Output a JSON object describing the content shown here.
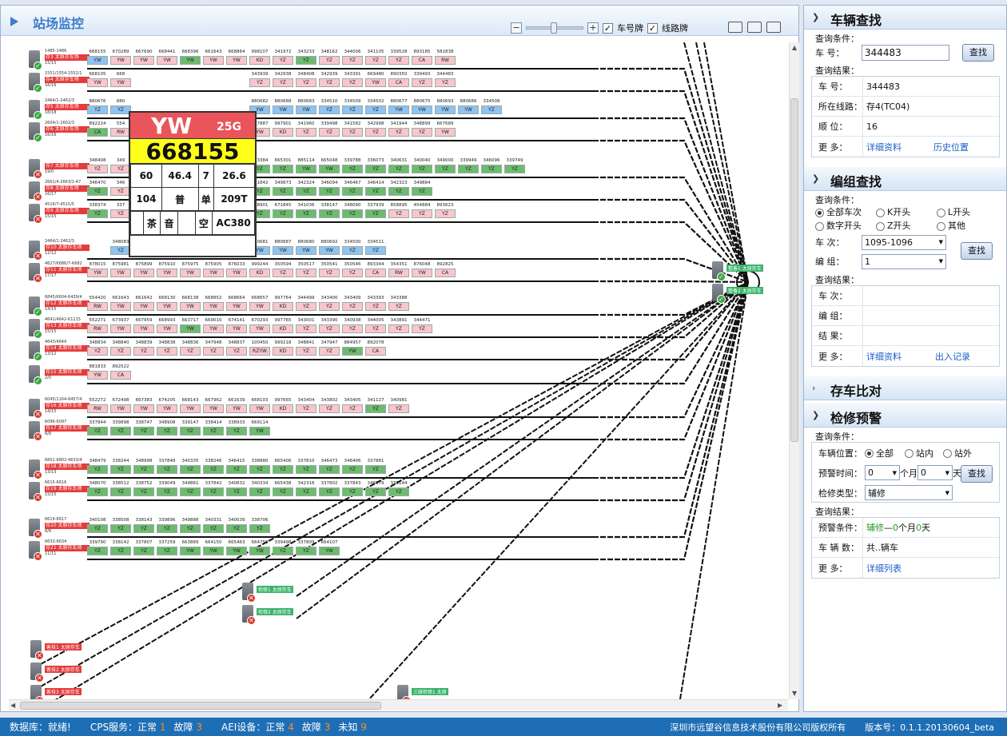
{
  "panel_title": "站场监控",
  "toolbar": {
    "zoom_out": "−",
    "zoom_in": "+",
    "car_plate_label": "车号牌",
    "line_plate_label": "线路牌"
  },
  "popup": {
    "type": "YW",
    "grade": "25G",
    "number": "668155",
    "cells": [
      [
        "60",
        "46.4",
        "7",
        "26.6"
      ],
      [
        "104",
        "普",
        "单",
        "209T"
      ],
      [
        "",
        "茶",
        "音",
        "",
        "空",
        "AC380"
      ]
    ]
  },
  "tracks": [
    {
      "name": "存3 太原存车场",
      "code": "1485-1486",
      "count": "15/15",
      "status": "ok",
      "nums": [
        "668155",
        "670289",
        "667690",
        "668441",
        "668396",
        "661643",
        "668864",
        "998107",
        "341972",
        "343233",
        "348162",
        "344006",
        "341105",
        "339528",
        "893185",
        "581838"
      ],
      "types": [
        "YW",
        "YW",
        "YW",
        "YW",
        "YW",
        "YW",
        "YW",
        "KD",
        "YZ",
        "YZ",
        "YZ",
        "YZ",
        "YZ",
        "YZ",
        "CA",
        "RW"
      ],
      "colors": [
        "b",
        "p",
        "p",
        "p",
        "g",
        "p",
        "p",
        "p",
        "p",
        "g",
        "p",
        "p",
        "p",
        "p",
        "p",
        "p"
      ]
    },
    {
      "name": "存4 太原存车场",
      "code": "1551/1554-1552/1",
      "count": "16/16",
      "status": "ok",
      "nums": [
        "668105",
        "668",
        "",
        "",
        "",
        "",
        "",
        "343939",
        "342938",
        "348408",
        "342939",
        "343391",
        "669480",
        "890350",
        "339493",
        "344483"
      ],
      "types": [
        "YW",
        "YW",
        "",
        "",
        "",
        "",
        "",
        "YZ",
        "YZ",
        "YZ",
        "YZ",
        "YZ",
        "YW",
        "CA",
        "YZ",
        "YZ"
      ],
      "colors": [
        "p",
        "p",
        "p",
        "p",
        "p",
        "p",
        "p",
        "p",
        "p",
        "p",
        "p",
        "p",
        "p",
        "p",
        "p",
        "p"
      ]
    },
    {
      "name": "存5 太原存车场",
      "code": "2464/1-2462/3",
      "count": "18/18",
      "status": "ok",
      "nums": [
        "880676",
        "880",
        "",
        "",
        "",
        "",
        "",
        "880682",
        "880688",
        "880683",
        "334510",
        "334509",
        "334502",
        "880677",
        "880675",
        "880693",
        "880686",
        "334508"
      ],
      "types": [
        "YZ",
        "YZ",
        "",
        "",
        "",
        "",
        "",
        "YW",
        "YW",
        "YW",
        "YZ",
        "YZ",
        "YZ",
        "YW",
        "YW",
        "YW",
        "YW",
        "YZ"
      ],
      "colors": [
        "b",
        "b",
        "b",
        "b",
        "b",
        "b",
        "b",
        "b",
        "b",
        "b",
        "b",
        "b",
        "b",
        "b",
        "b",
        "b",
        "b",
        "b"
      ]
    },
    {
      "name": "存6 太原存车场",
      "code": "2604/1-2602/3",
      "count": "16/16",
      "status": "ok",
      "nums": [
        "892224",
        "554",
        "",
        "",
        "",
        "",
        "",
        "667887",
        "997901",
        "341960",
        "339498",
        "341582",
        "342998",
        "341944",
        "348899",
        "667689"
      ],
      "types": [
        "CA",
        "RW",
        "",
        "",
        "",
        "",
        "",
        "YW",
        "KD",
        "YZ",
        "YZ",
        "YZ",
        "YZ",
        "YZ",
        "YZ",
        "YW"
      ],
      "colors": [
        "g",
        "p",
        "p",
        "p",
        "p",
        "p",
        "p",
        "p",
        "p",
        "p",
        "p",
        "p",
        "p",
        "p",
        "p",
        "p"
      ]
    },
    {
      "name": "存7 太原存车场",
      "code": "",
      "count": "19/0",
      "status": "err",
      "nums": [
        "348408",
        "349",
        "",
        "",
        "",
        "",
        "",
        "553384",
        "665301",
        "885114",
        "665048",
        "339788",
        "336073",
        "340631",
        "340040",
        "349000",
        "339949",
        "346096",
        "339749"
      ],
      "types": [
        "YZ",
        "YZ",
        "",
        "",
        "",
        "",
        "",
        "YZ",
        "YZ",
        "YW",
        "YW",
        "YZ",
        "YZ",
        "YZ",
        "YZ",
        "YZ",
        "YZ",
        "YZ",
        "YZ"
      ],
      "colors": [
        "p",
        "p",
        "p",
        "p",
        "p",
        "p",
        "p",
        "g",
        "g",
        "g",
        "g",
        "g",
        "g",
        "g",
        "g",
        "g",
        "g",
        "g",
        "g"
      ]
    },
    {
      "name": "存8 太原存车场",
      "code": "2661/4-2663/1-47",
      "count": "16/17",
      "status": "err",
      "nums": [
        "346470",
        "346",
        "",
        "",
        "",
        "",
        "",
        "671842",
        "349873",
        "342324",
        "346094",
        "346467",
        "346414",
        "342323",
        "349884"
      ],
      "types": [
        "YZ",
        "YZ",
        "",
        "",
        "",
        "",
        "",
        "YZ",
        "YZ",
        "YZ",
        "YZ",
        "YZ",
        "YZ",
        "YZ",
        "YZ"
      ],
      "colors": [
        "g",
        "p",
        "p",
        "p",
        "p",
        "p",
        "p",
        "g",
        "g",
        "g",
        "g",
        "g",
        "g",
        "g",
        "g"
      ]
    },
    {
      "name": "存9 太原存车场",
      "code": "4516/7-4515/5",
      "count": "15/15",
      "status": "err",
      "nums": [
        "338374",
        "337",
        "",
        "",
        "",
        "",
        "",
        "348901",
        "671845",
        "341036",
        "338147",
        "348090",
        "337939",
        "858895",
        "454884",
        "893623"
      ],
      "types": [
        "YZ",
        "YZ",
        "",
        "",
        "",
        "",
        "",
        "YZ",
        "YZ",
        "YZ",
        "YZ",
        "YZ",
        "YZ",
        "YZ",
        "YZ",
        "YZ"
      ],
      "colors": [
        "g",
        "p",
        "p",
        "p",
        "p",
        "p",
        "p",
        "g",
        "g",
        "g",
        "g",
        "g",
        "g",
        "p",
        "p",
        "p"
      ]
    },
    {
      "name": "存10 太原存车场",
      "code": "2464/1-2462/3",
      "count": "12/12",
      "status": "err",
      "nums": [
        "",
        "348083",
        "354306",
        "354513",
        "880678",
        "880689",
        "880684",
        "880681",
        "880687",
        "880680",
        "880692",
        "334500",
        "334511"
      ],
      "types": [
        "",
        "YZ",
        "YZ",
        "YZ",
        "YW",
        "YW",
        "YW",
        "YW",
        "YW",
        "YW",
        "YW",
        "YZ",
        "YZ"
      ],
      "colors": [
        "w",
        "b",
        "b",
        "b",
        "b",
        "b",
        "b",
        "b",
        "b",
        "b",
        "b",
        "b",
        "b"
      ]
    },
    {
      "name": "存11 太原存车场",
      "code": "4627/K686/7-K682",
      "count": "17/17",
      "status": "err",
      "nums": [
        "878015",
        "875981",
        "875899",
        "875910",
        "875975",
        "875905",
        "876033",
        "999244",
        "350594",
        "350517",
        "350541",
        "350546",
        "893344",
        "354351",
        "876048",
        "892825"
      ],
      "types": [
        "YW",
        "YW",
        "YW",
        "YW",
        "YW",
        "YW",
        "YW",
        "KD",
        "YZ",
        "YZ",
        "YZ",
        "YZ",
        "CA",
        "RW",
        "YW",
        "CA"
      ],
      "colors": [
        "p",
        "p",
        "p",
        "p",
        "p",
        "p",
        "p",
        "p",
        "p",
        "p",
        "p",
        "p",
        "p",
        "p",
        "p",
        "p"
      ]
    },
    {
      "name": "存12 太原存车场",
      "code": "6845/K604-6439/4",
      "count": "14/15",
      "status": "ok",
      "nums": [
        "554420",
        "661643",
        "661642",
        "668130",
        "668138",
        "668852",
        "668664",
        "668657",
        "997764",
        "344499",
        "343400",
        "343409",
        "343393",
        "343388"
      ],
      "types": [
        "RW",
        "YW",
        "YW",
        "YW",
        "YW",
        "YW",
        "YW",
        "YW",
        "KD",
        "YZ",
        "YZ",
        "YZ",
        "YZ",
        "YZ"
      ],
      "colors": [
        "p",
        "p",
        "p",
        "p",
        "p",
        "p",
        "p",
        "p",
        "p",
        "p",
        "p",
        "p",
        "p",
        "p"
      ]
    },
    {
      "name": "存13 太原存车场",
      "code": "4641/4642-K1115",
      "count": "15/15",
      "status": "ok",
      "nums": [
        "552271",
        "673937",
        "667959",
        "668993",
        "663717",
        "669010",
        "674141",
        "670293",
        "997765",
        "343001",
        "343390",
        "340938",
        "344005",
        "343891",
        "344471"
      ],
      "types": [
        "RW",
        "YW",
        "YW",
        "YW",
        "YW",
        "YW",
        "YW",
        "YW",
        "KD",
        "YZ",
        "YZ",
        "YZ",
        "YZ",
        "YZ",
        "YZ"
      ],
      "colors": [
        "p",
        "p",
        "p",
        "p",
        "g",
        "p",
        "p",
        "p",
        "p",
        "p",
        "p",
        "p",
        "p",
        "p",
        "p"
      ]
    },
    {
      "name": "存14 太原存车场",
      "code": "4643/4644",
      "count": "13/12",
      "status": "ok",
      "nums": [
        "348834",
        "348840",
        "348839",
        "348838",
        "348836",
        "347948",
        "348837",
        "100450",
        "999218",
        "348841",
        "347947",
        "884957",
        "892078"
      ],
      "types": [
        "YZ",
        "YZ",
        "YZ",
        "YZ",
        "YZ",
        "YZ",
        "YZ",
        "RZYW",
        "KD",
        "YZ",
        "YZ",
        "YW",
        "CA"
      ],
      "colors": [
        "p",
        "p",
        "p",
        "p",
        "p",
        "p",
        "p",
        "p",
        "p",
        "p",
        "p",
        "g",
        "p"
      ]
    },
    {
      "name": "存15 太原存车场",
      "code": "",
      "count": "2/0",
      "status": "ok",
      "nums": [
        "881833",
        "892522"
      ],
      "types": [
        "YW",
        "CA"
      ],
      "colors": [
        "p",
        "p"
      ]
    },
    {
      "name": "存16 太原存车场",
      "code": "6045/1164-6457/4",
      "count": "14/15",
      "status": "err",
      "nums": [
        "552272",
        "672498",
        "667383",
        "674205",
        "668143",
        "667962",
        "661639",
        "668103",
        "997665",
        "343404",
        "343802",
        "343405",
        "341127",
        "340981"
      ],
      "types": [
        "RW",
        "YW",
        "YW",
        "YW",
        "YW",
        "YW",
        "YW",
        "YW",
        "KD",
        "YZ",
        "YZ",
        "YZ",
        "YZ",
        "YZ"
      ],
      "colors": [
        "p",
        "p",
        "p",
        "p",
        "p",
        "p",
        "p",
        "p",
        "p",
        "p",
        "p",
        "p",
        "g",
        "p"
      ]
    },
    {
      "name": "存17 太原存车场",
      "code": "6096-6097",
      "count": "8/8",
      "status": "err",
      "nums": [
        "337844",
        "339898",
        "338747",
        "348908",
        "339147",
        "338414",
        "338933",
        "669114"
      ],
      "types": [
        "YZ",
        "YZ",
        "YZ",
        "YZ",
        "YZ",
        "YZ",
        "YZ",
        "YW"
      ],
      "colors": [
        "g",
        "g",
        "g",
        "g",
        "g",
        "g",
        "g",
        "g"
      ]
    },
    {
      "name": "存18 太原存车场",
      "code": "6801-6802-4633/4",
      "count": "13/13",
      "status": "err",
      "nums": [
        "348479",
        "338244",
        "348998",
        "337848",
        "340335",
        "338246",
        "346415",
        "338880",
        "665406",
        "337810",
        "346473",
        "346406",
        "337881"
      ],
      "types": [
        "YZ",
        "YZ",
        "YZ",
        "YZ",
        "YZ",
        "YZ",
        "YZ",
        "YZ",
        "YZ",
        "YZ",
        "YZ",
        "YZ",
        "YZ"
      ],
      "colors": [
        "g",
        "g",
        "g",
        "g",
        "g",
        "g",
        "g",
        "g",
        "g",
        "g",
        "g",
        "g",
        "g"
      ]
    },
    {
      "name": "存19 太原存车场",
      "code": "6615-6616",
      "count": "15/15",
      "status": "err",
      "nums": [
        "348070",
        "338512",
        "338752",
        "339049",
        "349861",
        "337842",
        "340832",
        "340334",
        "665438",
        "342316",
        "337802",
        "337843",
        "346079",
        "338144"
      ],
      "types": [
        "YZ",
        "YZ",
        "YZ",
        "YZ",
        "YZ",
        "YZ",
        "YZ",
        "YZ",
        "YZ",
        "YZ",
        "YZ",
        "YZ",
        "YZ",
        "YZ"
      ],
      "colors": [
        "g",
        "g",
        "g",
        "g",
        "g",
        "g",
        "g",
        "g",
        "g",
        "g",
        "g",
        "g",
        "g",
        "g"
      ]
    },
    {
      "name": "存20 太原存车场",
      "code": "6619-6617",
      "count": "8/8",
      "status": "err",
      "nums": [
        "340108",
        "338508",
        "338143",
        "339896",
        "349888",
        "340331",
        "340039",
        "338706"
      ],
      "types": [
        "YZ",
        "YZ",
        "YZ",
        "YZ",
        "YZ",
        "YZ",
        "YZ",
        "YZ"
      ],
      "colors": [
        "g",
        "g",
        "g",
        "g",
        "g",
        "g",
        "g",
        "g"
      ]
    },
    {
      "name": "存21 太原存车场",
      "code": "6633-6634",
      "count": "11/11",
      "status": "err",
      "nums": [
        "339790",
        "338142",
        "337807",
        "337259",
        "663889",
        "664150",
        "665463",
        "664758",
        "339498",
        "337809",
        "664107"
      ],
      "types": [
        "YZ",
        "YZ",
        "YZ",
        "YZ",
        "YW",
        "YW",
        "YW",
        "YW",
        "YZ",
        "YZ",
        "YW"
      ],
      "colors": [
        "g",
        "g",
        "g",
        "g",
        "g",
        "g",
        "g",
        "g",
        "g",
        "g",
        "g"
      ]
    }
  ],
  "side_stations": [
    {
      "label": "整备1 太原存车",
      "status": "ok"
    },
    {
      "label": "整备2 太原存车",
      "status": "ok"
    }
  ],
  "repair_tracks": [
    {
      "label": "检修1 太原存车",
      "count": "0/0"
    },
    {
      "label": "检修2 太原存车",
      "count": "0/0"
    }
  ],
  "bottom_tracks": [
    {
      "label": "客技1 太原存车",
      "count": "0/0"
    },
    {
      "label": "客技2 太原存车",
      "count": "0/0"
    },
    {
      "label": "客技3 太原存车",
      "count": "1095-1096"
    },
    {
      "label": "三级检修1 太原"
    }
  ],
  "vehicle_search": {
    "title": "车辆查找",
    "cond_label": "查询条件：",
    "car_no_key": "车    号：",
    "car_no_value": "344483",
    "search_btn": "查找",
    "result_label": "查询结果：",
    "rows": [
      {
        "k": "车    号：",
        "v": "344483"
      },
      {
        "k": "所在线路：",
        "v": "存4(TC04)"
      },
      {
        "k": "顺    位：",
        "v": "16"
      }
    ],
    "more_key": "更    多：",
    "more_link1": "详细资料",
    "more_link2": "历史位置"
  },
  "consist_search": {
    "title": "编组查找",
    "cond_label": "查询条件：",
    "radios": [
      [
        "全部车次",
        "K开头",
        "L开头"
      ],
      [
        "数字开头",
        "Z开头",
        "其他"
      ]
    ],
    "train_key": "车    次：",
    "train_value": "1095-1096",
    "group_key": "编    组：",
    "group_value": "1",
    "search_btn": "查找",
    "result_label": "查询结果：",
    "rows": [
      {
        "k": "车    次：",
        "v": ""
      },
      {
        "k": "编    组：",
        "v": ""
      },
      {
        "k": "结    果：",
        "v": ""
      }
    ],
    "more_key": "更    多：",
    "more_link1": "详细资料",
    "more_link2": "出入记录"
  },
  "compare": {
    "title": "存车比对"
  },
  "maintenance": {
    "title": "检修预警",
    "cond_label": "查询条件：",
    "pos_key": "车辆位置：",
    "pos_opts": [
      "全部",
      "站内",
      "站外"
    ],
    "time_key": "预警时间：",
    "month_value": "0",
    "month_unit": "个月",
    "day_value": "0",
    "day_unit": "天",
    "type_key": "检修类型：",
    "type_value": "辅修",
    "search_btn": "查找",
    "result_label": "查询结果：",
    "cond_key": "预警条件：",
    "cond_parts": [
      "辅修",
      "—",
      "0",
      "个月",
      "0",
      "天"
    ],
    "count_key": "车 辆 数：",
    "count_value": "共..辆车",
    "more_key": "更    多：",
    "more_link": "详细列表"
  },
  "status_bar": {
    "db_label": "数据库：",
    "db_value": "就绪!",
    "cps_label": "CPS服务：正常",
    "cps_ok": "1",
    "cps_fault_label": "故障",
    "cps_fault": "3",
    "aei_label": "AEI设备：正常",
    "aei_ok": "4",
    "aei_fault_label": "故障",
    "aei_fault": "3",
    "aei_unknown_label": "未知",
    "aei_unknown": "9",
    "company": "深圳市远望谷信息技术股份有限公司版权所有",
    "version": "版本号：0.1.1.20130604_beta"
  }
}
